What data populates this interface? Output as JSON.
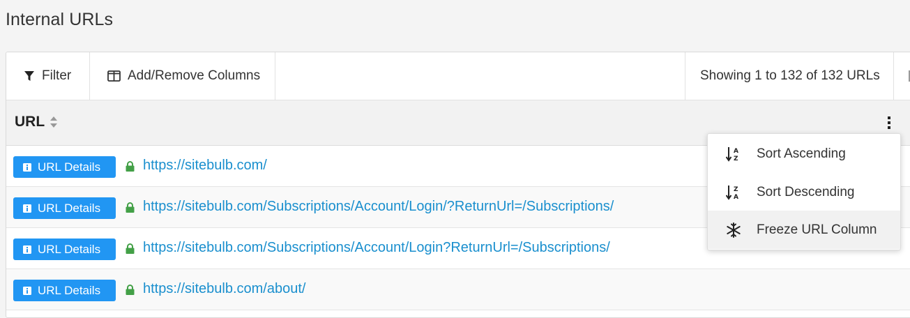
{
  "page": {
    "title": "Internal URLs"
  },
  "toolbar": {
    "filter_label": "Filter",
    "columns_label": "Add/Remove Columns",
    "showing_text": "Showing 1 to 132 of 132 URLs"
  },
  "table": {
    "column_header": "URL",
    "details_label": "URL Details",
    "rows": [
      {
        "url": "https://sitebulb.com/"
      },
      {
        "url": "https://sitebulb.com/Subscriptions/Account/Login/?ReturnUrl=/Subscriptions/"
      },
      {
        "url": "https://sitebulb.com/Subscriptions/Account/Login?ReturnUrl=/Subscriptions/"
      },
      {
        "url": "https://sitebulb.com/about/"
      }
    ]
  },
  "column_menu": {
    "items": [
      {
        "label": "Sort Ascending",
        "icon": "sort-ascending-icon"
      },
      {
        "label": "Sort Descending",
        "icon": "sort-descending-icon"
      },
      {
        "label": "Freeze URL Column",
        "icon": "snowflake-icon"
      }
    ]
  },
  "colors": {
    "accent": "#2196f3",
    "link": "#1a8fce",
    "lock": "#43a047"
  }
}
